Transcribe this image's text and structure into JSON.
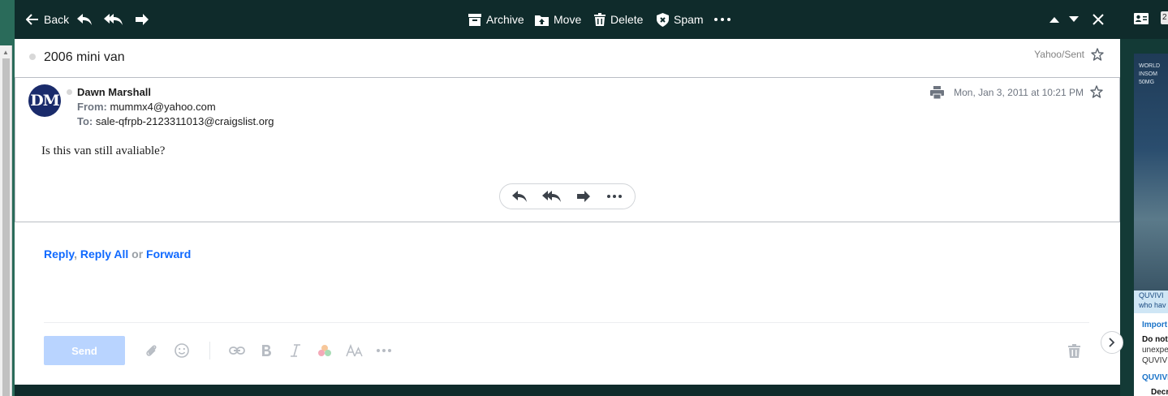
{
  "toolbar": {
    "back_label": "Back",
    "archive_label": "Archive",
    "move_label": "Move",
    "delete_label": "Delete",
    "spam_label": "Spam",
    "icons": [
      "arrow-left-icon",
      "reply-icon",
      "reply-all-icon",
      "forward-icon",
      "archive-icon",
      "move-icon",
      "trash-icon",
      "shield-icon",
      "more-icon",
      "chevron-up-icon",
      "chevron-down-icon",
      "close-icon"
    ]
  },
  "message": {
    "subject": "2006 mini van",
    "folder": "Yahoo/Sent",
    "avatar_initials": "DM",
    "sender_name": "Dawn Marshall",
    "from_label": "From:",
    "from_value": "mummx4@yahoo.com",
    "to_label": "To:",
    "to_value": "sale-qfrpb-2123311013@craigslist.org",
    "date": "Mon, Jan 3, 2011 at 10:21 PM",
    "body": "Is this van still avaliable?"
  },
  "reply": {
    "reply_label": "Reply",
    "comma": ",",
    "reply_all_label": "Reply All",
    "or_label": "or",
    "forward_label": "Forward",
    "send_label": "Send"
  },
  "ad": {
    "headline_lines": [
      "WORLD",
      "INSOM",
      "50MG"
    ],
    "caption_lines": [
      "QUVIVI",
      "who hav"
    ],
    "text_1": "Import",
    "text_2": "Do not",
    "text_3": "unexpe",
    "text_4": "QUVIV",
    "text_5": "QUVIVI",
    "text_6": "Decr"
  },
  "right_top": {
    "badge": "2"
  },
  "colors": {
    "toolbar_bg": "#0f2b2b",
    "link_blue": "#0f69ff",
    "send_disabled": "#b9d4ff",
    "avatar_bg": "#1a2b6b"
  }
}
